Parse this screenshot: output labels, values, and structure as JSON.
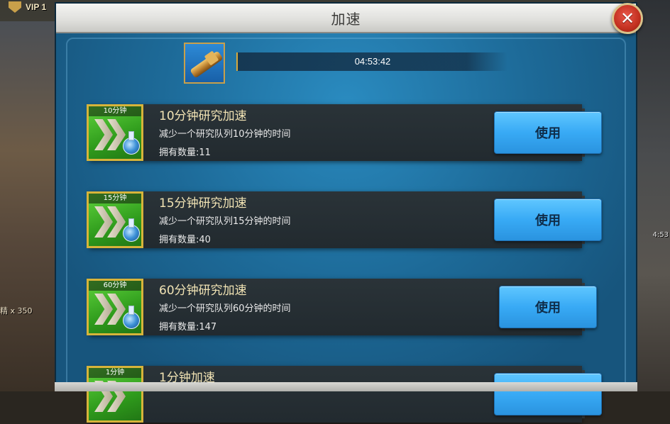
{
  "background": {
    "vip_label": "VIP 1",
    "left_text": "精 x 350",
    "right_time": "4:53"
  },
  "dialog": {
    "title": "加速",
    "close_symbol": "✕"
  },
  "timer": {
    "remaining": "04:53:42"
  },
  "items": [
    {
      "tag": "10分钟",
      "name": "10分钟研究加速",
      "desc": "减少一个研究队列10分钟的时间",
      "count": "拥有数量:11",
      "button": "使用"
    },
    {
      "tag": "15分钟",
      "name": "15分钟研究加速",
      "desc": "减少一个研究队列15分钟的时间",
      "count": "拥有数量:40",
      "button": "使用"
    },
    {
      "tag": "60分钟",
      "name": "60分钟研究加速",
      "desc": "减少一个研究队列60分钟的时间",
      "count": "拥有数量:147",
      "button": "使用"
    },
    {
      "tag": "1分钟",
      "name": "1分钟加速",
      "desc": "",
      "count": "",
      "button": ""
    }
  ]
}
